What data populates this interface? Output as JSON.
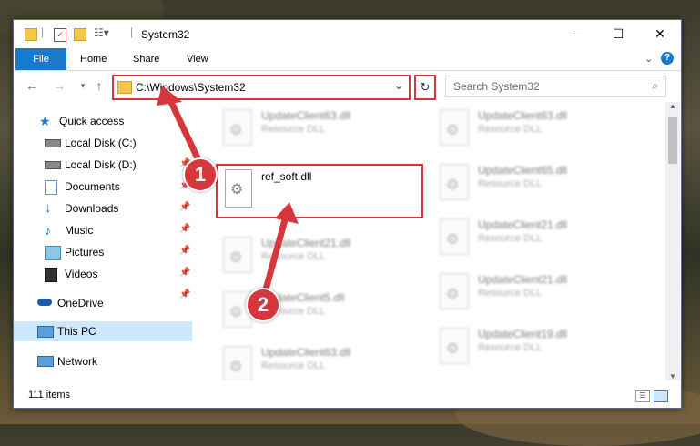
{
  "window": {
    "title": "System32"
  },
  "ribbon": {
    "file": "File",
    "home": "Home",
    "share": "Share",
    "view": "View"
  },
  "nav": {
    "address": "C:\\Windows\\System32",
    "search_placeholder": "Search System32"
  },
  "sidebar": {
    "quick_access": "Quick access",
    "items": [
      {
        "label": "Local Disk (C:)",
        "icon": "drive-icon",
        "pinned": true
      },
      {
        "label": "Local Disk (D:)",
        "icon": "drive-icon",
        "pinned": true
      },
      {
        "label": "Documents",
        "icon": "documents-icon",
        "pinned": true
      },
      {
        "label": "Downloads",
        "icon": "downloads-icon",
        "pinned": true
      },
      {
        "label": "Music",
        "icon": "music-icon",
        "pinned": true
      },
      {
        "label": "Pictures",
        "icon": "pictures-icon",
        "pinned": true
      },
      {
        "label": "Videos",
        "icon": "videos-icon",
        "pinned": true
      }
    ],
    "onedrive": "OneDrive",
    "this_pc": "This PC",
    "network": "Network"
  },
  "files": {
    "selected": {
      "name": "ref_soft.dll"
    },
    "left_column": [
      {
        "name": "UpdateClient63.dll",
        "type": "Resource DLL"
      },
      {
        "name": "UpdateClient21.dll",
        "type": "Resource DLL"
      },
      {
        "name": "UpdateClient5.dll",
        "type": "Resource DLL"
      },
      {
        "name": "UpdateClient63.dll",
        "type": "Resource DLL"
      }
    ],
    "right_column": [
      {
        "name": "UpdateClient63.dll",
        "type": "Resource DLL"
      },
      {
        "name": "UpdateClient65.dll",
        "type": "Resource DLL"
      },
      {
        "name": "UpdateClient21.dll",
        "type": "Resource DLL"
      },
      {
        "name": "UpdateClient21.dll",
        "type": "Resource DLL"
      },
      {
        "name": "UpdateClient19.dll",
        "type": "Resource DLL"
      }
    ]
  },
  "status": {
    "items": "111 items"
  },
  "annotations": {
    "badge1": "1",
    "badge2": "2"
  },
  "colors": {
    "accent": "#1979ca",
    "highlight": "#d6373b",
    "selected_nav": "#cce8ff"
  }
}
